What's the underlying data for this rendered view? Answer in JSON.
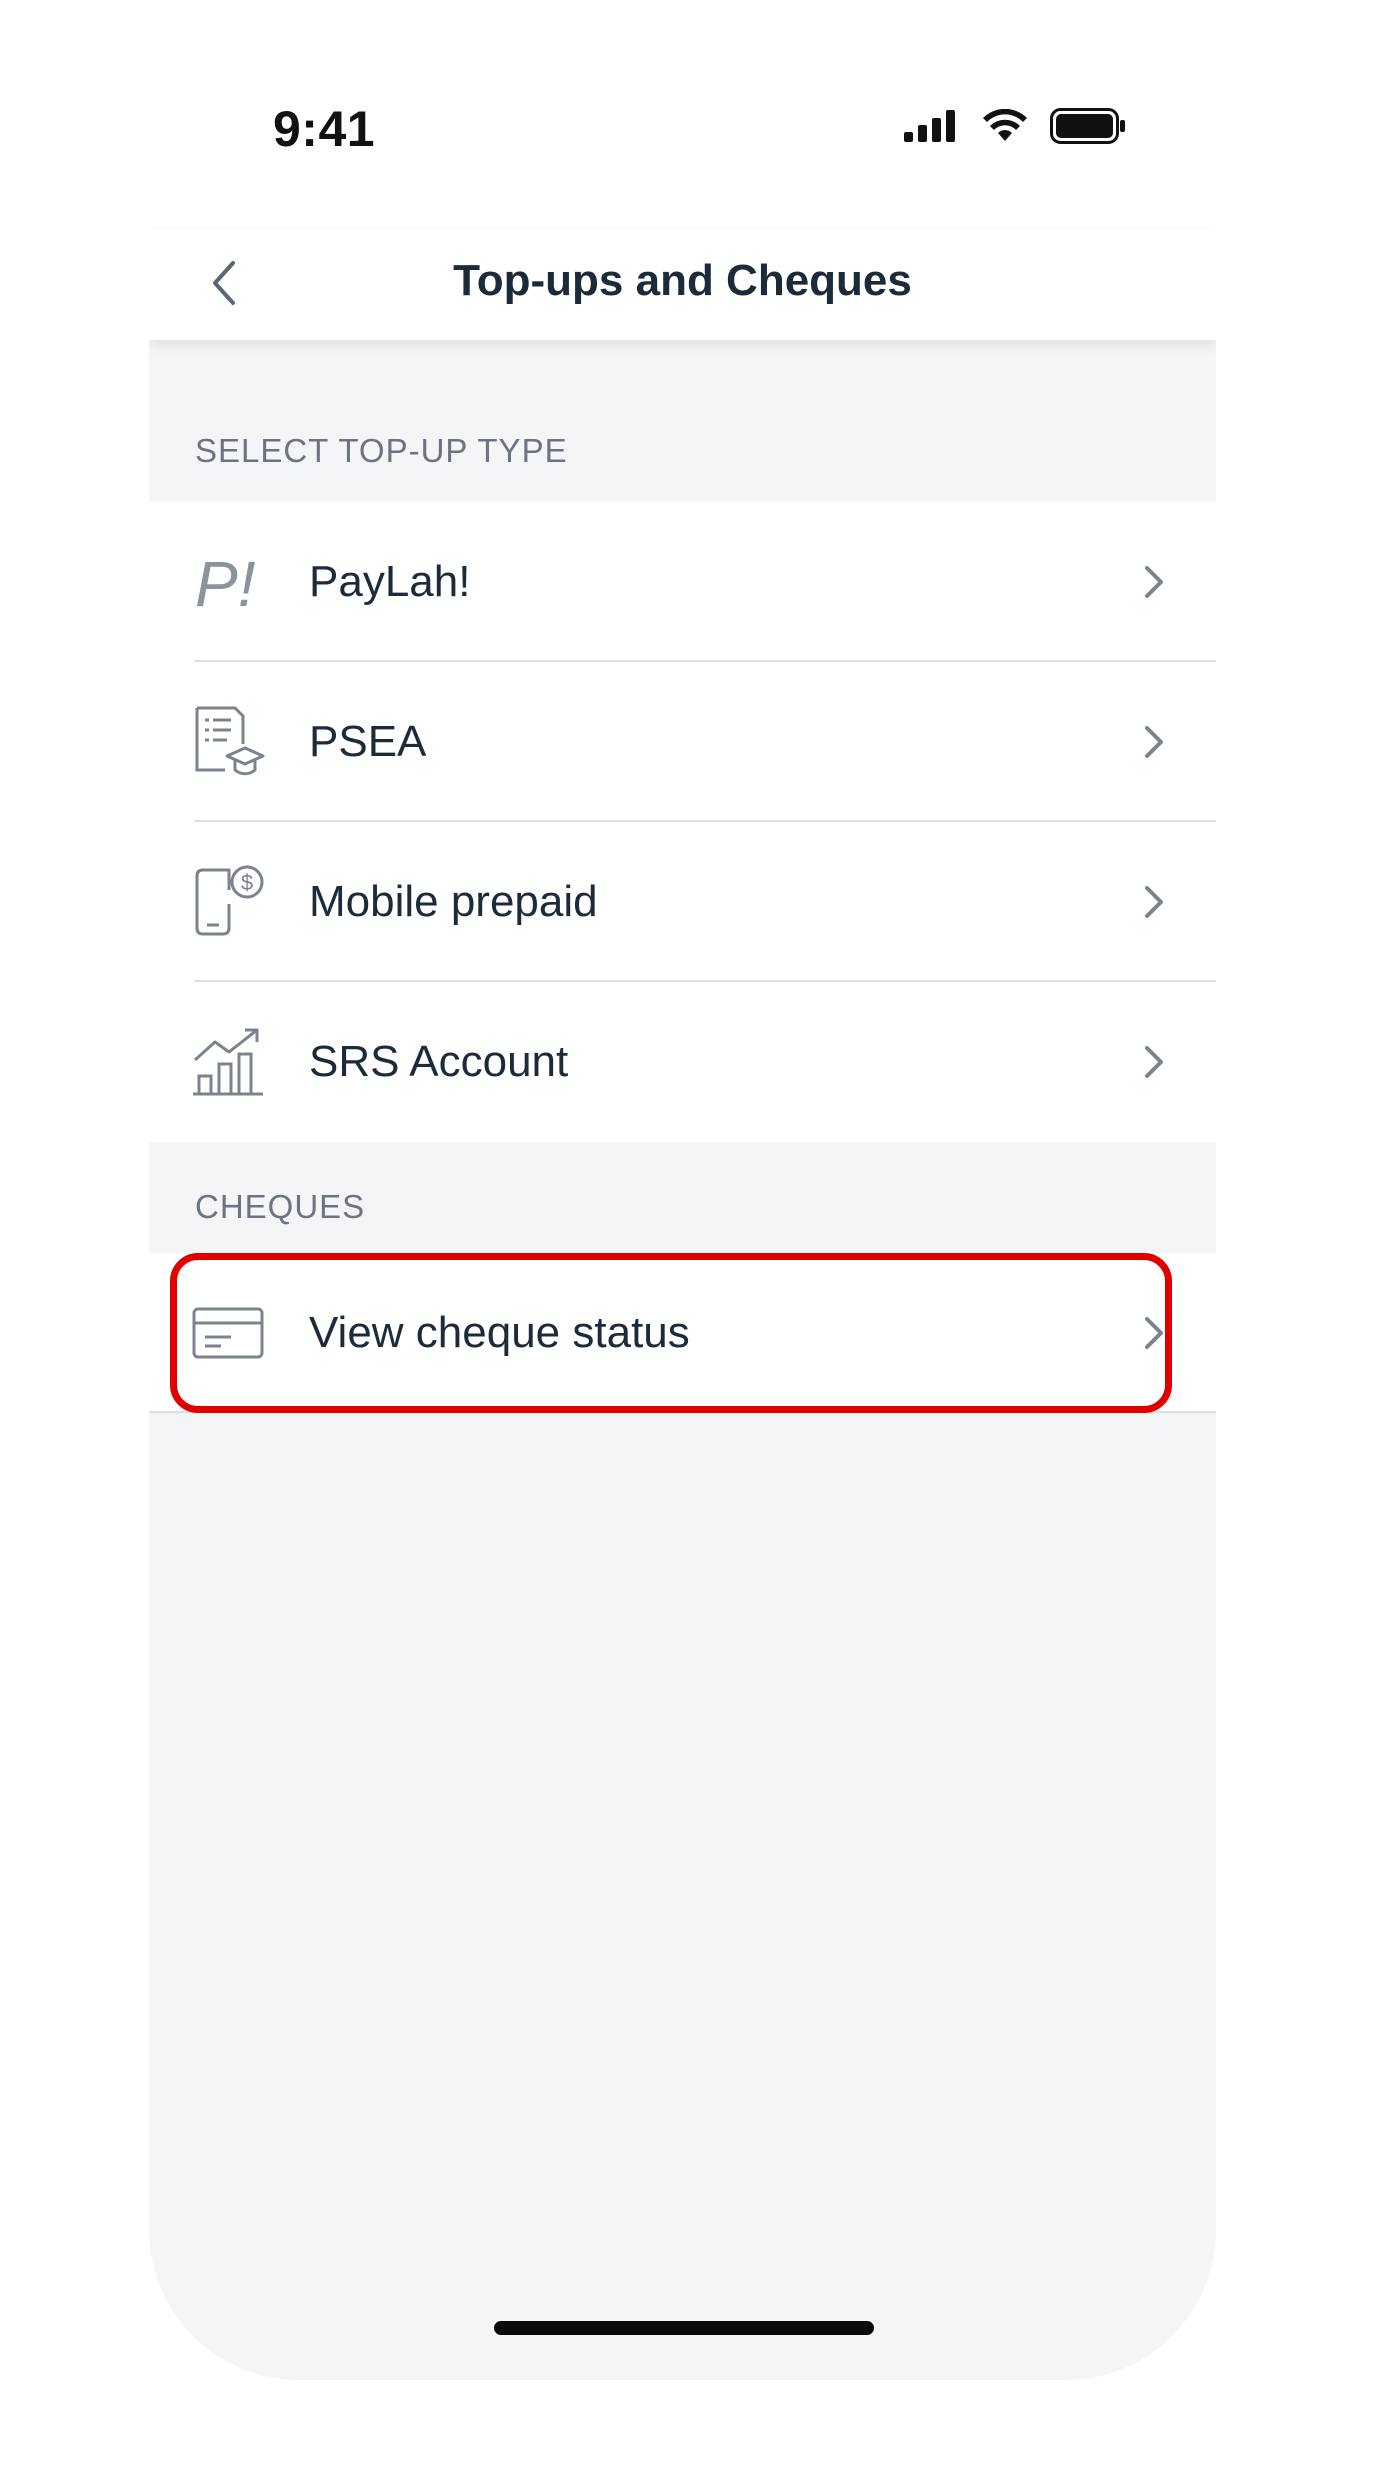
{
  "status_bar": {
    "time": "9:41"
  },
  "nav": {
    "title": "Top-ups and Cheques"
  },
  "sections": {
    "topup_header": "SELECT TOP-UP TYPE",
    "cheques_header": "CHEQUES"
  },
  "topup_items": [
    {
      "label": "PayLah!",
      "icon": "paylah-icon"
    },
    {
      "label": "PSEA",
      "icon": "psea-document-icon"
    },
    {
      "label": "Mobile prepaid",
      "icon": "mobile-prepaid-icon"
    },
    {
      "label": "SRS Account",
      "icon": "srs-chart-icon"
    }
  ],
  "cheque_items": [
    {
      "label": "View cheque status",
      "icon": "cheque-card-icon"
    }
  ],
  "colors": {
    "highlight": "#e00000",
    "text_primary": "#1c2b3a",
    "section_text": "#6b7480",
    "background": "#f4f5f7"
  }
}
